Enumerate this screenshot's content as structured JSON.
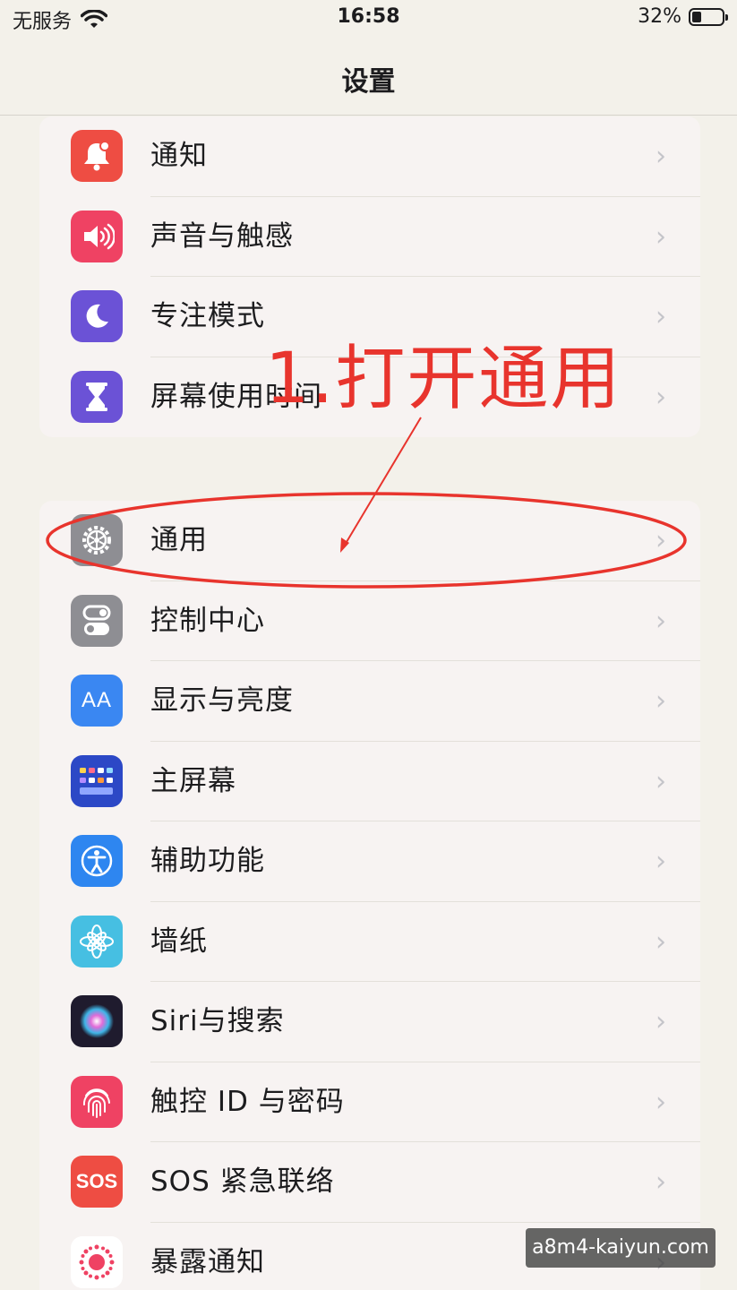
{
  "status_bar": {
    "carrier": "无服务",
    "wifi_icon": "wifi-icon",
    "time": "16:58",
    "battery_percent": "32%",
    "battery_level": 0.32
  },
  "nav": {
    "title": "设置"
  },
  "groups": [
    {
      "items": [
        {
          "label": "通知",
          "icon": "bell-icon",
          "color": "#ee4d43"
        },
        {
          "label": "声音与触感",
          "icon": "speaker-icon",
          "color": "#ef4263"
        },
        {
          "label": "专注模式",
          "icon": "moon-icon",
          "color": "#6b52d6"
        },
        {
          "label": "屏幕使用时间",
          "icon": "hourglass-icon",
          "color": "#6b52d6"
        }
      ]
    },
    {
      "items": [
        {
          "label": "通用",
          "icon": "gear-icon",
          "color": "#8e8e93"
        },
        {
          "label": "控制中心",
          "icon": "toggles-icon",
          "color": "#8e8e93"
        },
        {
          "label": "显示与亮度",
          "icon": "text-size-icon",
          "color": "#3a87f2"
        },
        {
          "label": "主屏幕",
          "icon": "home-grid-icon",
          "color": "#2c48c6"
        },
        {
          "label": "辅助功能",
          "icon": "accessibility-icon",
          "color": "#2e86f0"
        },
        {
          "label": "墙纸",
          "icon": "flower-icon",
          "color": "#46bfe2"
        },
        {
          "label": "Siri与搜索",
          "icon": "siri-icon",
          "color": "#1f1b2e"
        },
        {
          "label": "触控 ID 与密码",
          "icon": "fingerprint-icon",
          "color": "#ef4263"
        },
        {
          "label": "SOS 紧急联络",
          "icon": "sos-icon",
          "color": "#ee4d43"
        },
        {
          "label": "暴露通知",
          "icon": "exposure-icon",
          "color": "#ffffff"
        }
      ]
    }
  ],
  "chevron": "›",
  "sos_text": "SOS",
  "text_size_glyph": "AA",
  "annotation": {
    "text": "1.打开通用",
    "color": "#e8342d"
  },
  "watermark": "a8m4-kaiyun.com"
}
